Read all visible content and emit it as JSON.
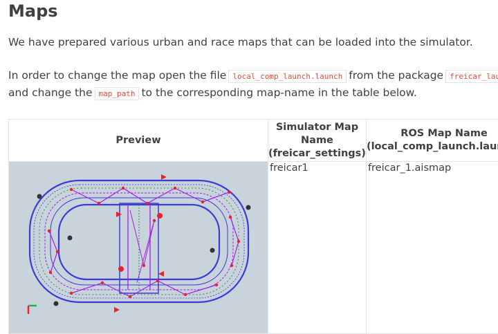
{
  "page": {
    "title": "Maps",
    "intro": "We have prepared various urban and race maps that can be loaded into the simulator.",
    "instr_part1": "In order to change the map open the file",
    "instr_code1": "local_comp_launch.launch",
    "instr_part2": "from the package",
    "instr_code2": "freicar_launch",
    "instr_part3": "and change the",
    "instr_code3": "map_path",
    "instr_part4": "to the corresponding map-name in the table below."
  },
  "table": {
    "headers": {
      "preview": "Preview",
      "sim_line1": "Simulator Map",
      "sim_line2": "Name",
      "sim_line3": "(freicar_settings)",
      "ros_line1": "ROS Map Name",
      "ros_line2": "(local_comp_launch.launch)"
    },
    "rows": [
      {
        "sim_name": "freicar1",
        "ros_name": "freicar_1.aismap"
      }
    ]
  },
  "colors": {
    "text": "#404040",
    "code": "#e74c3c",
    "map_bg": "#c9d3db",
    "track": "#3b3bd6",
    "lane": "#a020f0",
    "node": "#e8212b"
  }
}
